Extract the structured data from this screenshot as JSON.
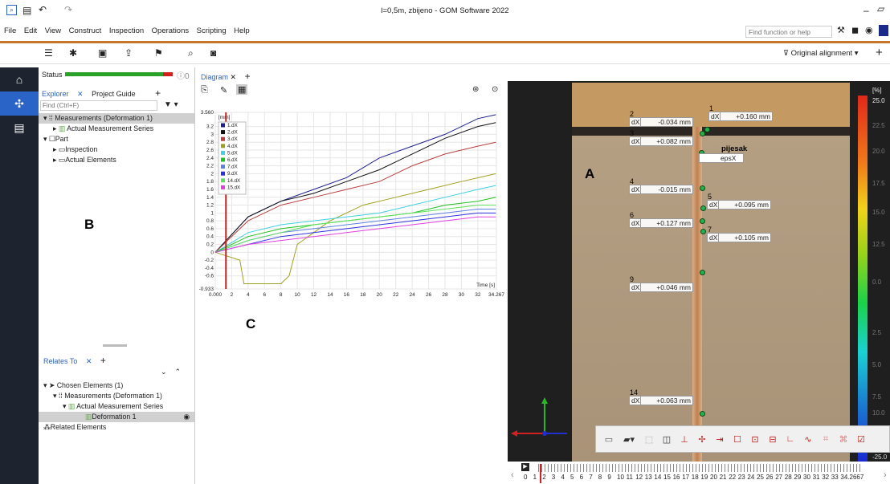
{
  "window": {
    "title": "l=0,5m, zbijeno - GOM Software 2022"
  },
  "menu": [
    "File",
    "Edit",
    "View",
    "Construct",
    "Inspection",
    "Operations",
    "Scripting",
    "Help"
  ],
  "search": {
    "placeholder": "Find function or help"
  },
  "alignment": {
    "label": "Original alignment"
  },
  "status": {
    "label": "Status",
    "info_count": "0"
  },
  "explorer": {
    "tab_explorer": "Explorer",
    "tab_guide": "Project Guide",
    "find_placeholder": "Find (Ctrl+F)",
    "tree": [
      "Measurements (Deformation 1)",
      "Actual Measurement Series",
      "Part",
      "Inspection",
      "Actual Elements"
    ]
  },
  "relates": {
    "tab": "Relates To",
    "chosen": "Chosen Elements (1)",
    "measurements": "Measurements (Deformation 1)",
    "series": "Actual Measurement Series",
    "deformation": "Deformation 1",
    "related": "Related Elements"
  },
  "diagram": {
    "tab": "Diagram"
  },
  "letters": {
    "a": "A",
    "b": "B",
    "c": "C"
  },
  "chart_data": {
    "type": "line",
    "ylabel": "[mm]",
    "xlabel": "Time [s]",
    "xlim": [
      0,
      34.267
    ],
    "ylim": [
      -0.933,
      3.56
    ],
    "x_ticks": [
      "0.000",
      "2",
      "4",
      "6",
      "8",
      "10",
      "12",
      "14",
      "16",
      "18",
      "20",
      "22",
      "24",
      "26",
      "28",
      "30",
      "32",
      "34.267"
    ],
    "y_ticks": [
      "3.560",
      "3.2",
      "3",
      "2.8",
      "2.6",
      "2.4",
      "2.2",
      "2",
      "1.8",
      "1.6",
      "1.4",
      "1.2",
      "1",
      "0.8",
      "0.6",
      "0.4",
      "0.2",
      "0",
      "-0.2",
      "-0.4",
      "-0.6",
      "-0.933"
    ],
    "cursor_x": 1.3,
    "legend": [
      {
        "name": "1.dX",
        "color": "#1f1f8f"
      },
      {
        "name": "2.dX",
        "color": "#111111"
      },
      {
        "name": "3.dX",
        "color": "#b84040"
      },
      {
        "name": "4.dX",
        "color": "#a0a020"
      },
      {
        "name": "5.dX",
        "color": "#40d0e0"
      },
      {
        "name": "6.dX",
        "color": "#20c020"
      },
      {
        "name": "7.dX",
        "color": "#6080e0"
      },
      {
        "name": "9.dX",
        "color": "#3030e0"
      },
      {
        "name": "14.dX",
        "color": "#60e060"
      },
      {
        "name": "15.dX",
        "color": "#e040e0"
      }
    ],
    "series": [
      {
        "name": "1.dX",
        "color": "#1f1f8f",
        "points": [
          [
            0,
            0
          ],
          [
            4,
            0.9
          ],
          [
            8,
            1.3
          ],
          [
            12,
            1.6
          ],
          [
            16,
            1.9
          ],
          [
            20,
            2.4
          ],
          [
            24,
            2.7
          ],
          [
            28,
            3.0
          ],
          [
            32,
            3.4
          ],
          [
            34.2,
            3.5
          ]
        ]
      },
      {
        "name": "2.dX",
        "color": "#111111",
        "points": [
          [
            0,
            0
          ],
          [
            4,
            0.9
          ],
          [
            8,
            1.3
          ],
          [
            12,
            1.5
          ],
          [
            16,
            1.8
          ],
          [
            20,
            2.1
          ],
          [
            24,
            2.5
          ],
          [
            28,
            2.9
          ],
          [
            32,
            3.2
          ],
          [
            34.2,
            3.3
          ]
        ]
      },
      {
        "name": "3.dX",
        "color": "#b84040",
        "points": [
          [
            0,
            0
          ],
          [
            4,
            0.8
          ],
          [
            8,
            1.2
          ],
          [
            12,
            1.4
          ],
          [
            16,
            1.6
          ],
          [
            20,
            1.8
          ],
          [
            24,
            2.2
          ],
          [
            28,
            2.5
          ],
          [
            32,
            2.7
          ],
          [
            34.2,
            2.8
          ]
        ]
      },
      {
        "name": "4.dX",
        "color": "#a0a020",
        "points": [
          [
            0,
            0
          ],
          [
            3,
            -0.2
          ],
          [
            3.5,
            -0.8
          ],
          [
            8,
            -0.8
          ],
          [
            9,
            -0.6
          ],
          [
            10,
            0.2
          ],
          [
            14,
            0.8
          ],
          [
            18,
            1.2
          ],
          [
            22,
            1.4
          ],
          [
            26,
            1.6
          ],
          [
            30,
            1.8
          ],
          [
            34.2,
            2.0
          ]
        ]
      },
      {
        "name": "5.dX",
        "color": "#40d0e0",
        "points": [
          [
            0,
            0
          ],
          [
            4,
            0.5
          ],
          [
            8,
            0.7
          ],
          [
            12,
            0.8
          ],
          [
            16,
            0.9
          ],
          [
            20,
            1.0
          ],
          [
            24,
            1.2
          ],
          [
            28,
            1.4
          ],
          [
            32,
            1.6
          ],
          [
            34.2,
            1.7
          ]
        ]
      },
      {
        "name": "6.dX",
        "color": "#20c020",
        "points": [
          [
            0,
            0
          ],
          [
            4,
            0.4
          ],
          [
            8,
            0.6
          ],
          [
            12,
            0.7
          ],
          [
            16,
            0.8
          ],
          [
            20,
            0.9
          ],
          [
            24,
            1.0
          ],
          [
            28,
            1.2
          ],
          [
            32,
            1.3
          ],
          [
            34.2,
            1.4
          ]
        ]
      },
      {
        "name": "7.dX",
        "color": "#6080e0",
        "points": [
          [
            0,
            0
          ],
          [
            4,
            0.3
          ],
          [
            8,
            0.5
          ],
          [
            12,
            0.6
          ],
          [
            16,
            0.7
          ],
          [
            20,
            0.8
          ],
          [
            24,
            0.9
          ],
          [
            28,
            1.0
          ],
          [
            32,
            1.1
          ],
          [
            34.2,
            1.1
          ]
        ]
      },
      {
        "name": "9.dX",
        "color": "#3030e0",
        "points": [
          [
            0,
            0
          ],
          [
            4,
            0.2
          ],
          [
            8,
            0.4
          ],
          [
            12,
            0.5
          ],
          [
            16,
            0.6
          ],
          [
            20,
            0.7
          ],
          [
            24,
            0.8
          ],
          [
            28,
            0.9
          ],
          [
            32,
            1.0
          ],
          [
            34.2,
            1.0
          ]
        ]
      },
      {
        "name": "14.dX",
        "color": "#60e060",
        "points": [
          [
            0,
            0
          ],
          [
            4,
            0.3
          ],
          [
            8,
            0.5
          ],
          [
            12,
            0.7
          ],
          [
            16,
            0.8
          ],
          [
            20,
            0.9
          ],
          [
            24,
            1.0
          ],
          [
            28,
            1.1
          ],
          [
            32,
            1.2
          ],
          [
            34.2,
            1.2
          ]
        ]
      },
      {
        "name": "15.dX",
        "color": "#e040e0",
        "points": [
          [
            0,
            0
          ],
          [
            4,
            0.2
          ],
          [
            8,
            0.3
          ],
          [
            12,
            0.4
          ],
          [
            16,
            0.5
          ],
          [
            20,
            0.6
          ],
          [
            24,
            0.7
          ],
          [
            28,
            0.8
          ],
          [
            32,
            0.9
          ],
          [
            34.2,
            0.9
          ]
        ]
      }
    ]
  },
  "viewport": {
    "points": [
      {
        "n": "1",
        "value": "+0.160 mm"
      },
      {
        "n": "2",
        "value": "-0.034 mm"
      },
      {
        "n": "3",
        "value": "+0.082 mm"
      },
      {
        "n": "4",
        "value": "-0.015 mm"
      },
      {
        "n": "5",
        "value": "+0.095 mm"
      },
      {
        "n": "6",
        "value": "+0.127 mm"
      },
      {
        "n": "7",
        "value": "+0.105 mm"
      },
      {
        "n": "9",
        "value": "+0.046 mm"
      },
      {
        "n": "14",
        "value": "+0.063 mm"
      }
    ],
    "dx_label": "dX",
    "sand_label": "pijesak",
    "eps_label": "epsX",
    "colorbar_unit": "[%]",
    "colorbar_top": "25.0",
    "colorbar_ticks": [
      "22.5",
      "20.0",
      "17.5",
      "15.0",
      "12.5",
      "10.0",
      "7.5",
      "5.0",
      "2.5",
      "0.0"
    ],
    "colorbar_bottom": "-25.0"
  },
  "timeline": {
    "ticks": [
      "0",
      "1",
      "2",
      "3",
      "4",
      "5",
      "6",
      "7",
      "8",
      "9",
      "10",
      "11",
      "12",
      "13",
      "14",
      "15",
      "16",
      "17",
      "18",
      "19",
      "20",
      "21",
      "22",
      "23",
      "24",
      "25",
      "26",
      "27",
      "28",
      "29",
      "30",
      "31",
      "32",
      "33",
      "34.2667"
    ]
  }
}
